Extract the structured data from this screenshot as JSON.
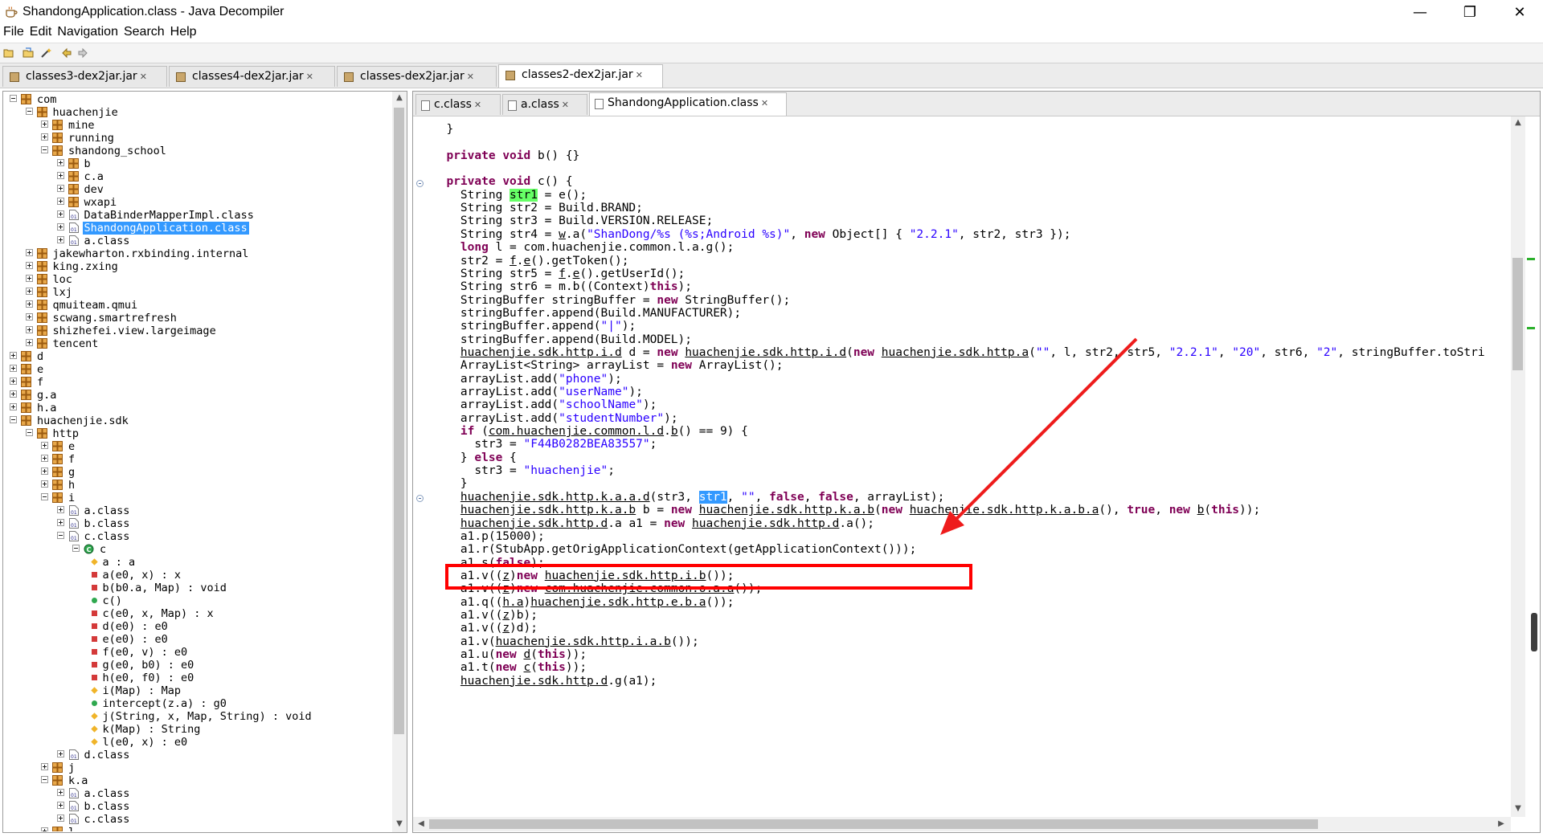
{
  "window": {
    "title": "ShandongApplication.class - Java Decompiler",
    "minimize_glyph": "—",
    "maximize_glyph": "❐",
    "close_glyph": "✕"
  },
  "menu": [
    "File",
    "Edit",
    "Navigation",
    "Search",
    "Help"
  ],
  "toolbar_icons": [
    "open-folder-icon",
    "open-file-icon",
    "wand-icon",
    "back-arrow-icon",
    "forward-arrow-icon"
  ],
  "jar_tabs": [
    {
      "label": "classes3-dex2jar.jar",
      "active": false
    },
    {
      "label": "classes4-dex2jar.jar",
      "active": false
    },
    {
      "label": "classes-dex2jar.jar",
      "active": false
    },
    {
      "label": "classes2-dex2jar.jar",
      "active": true
    }
  ],
  "file_tabs": [
    {
      "label": "c.class",
      "active": false
    },
    {
      "label": "a.class",
      "active": false
    },
    {
      "label": "ShandongApplication.class",
      "active": true
    }
  ],
  "tree": [
    {
      "label": "com",
      "depth": 0,
      "kind": "package",
      "exp": "minus"
    },
    {
      "label": "huachenjie",
      "depth": 1,
      "kind": "package",
      "exp": "minus"
    },
    {
      "label": "mine",
      "depth": 2,
      "kind": "package",
      "exp": "plus"
    },
    {
      "label": "running",
      "depth": 2,
      "kind": "package",
      "exp": "plus"
    },
    {
      "label": "shandong_school",
      "depth": 2,
      "kind": "package",
      "exp": "minus"
    },
    {
      "label": "b",
      "depth": 3,
      "kind": "package",
      "exp": "plus"
    },
    {
      "label": "c.a",
      "depth": 3,
      "kind": "package",
      "exp": "plus"
    },
    {
      "label": "dev",
      "depth": 3,
      "kind": "package",
      "exp": "plus"
    },
    {
      "label": "wxapi",
      "depth": 3,
      "kind": "package",
      "exp": "plus"
    },
    {
      "label": "DataBinderMapperImpl.class",
      "depth": 3,
      "kind": "class",
      "exp": "plus"
    },
    {
      "label": "ShandongApplication.class",
      "depth": 3,
      "kind": "class",
      "exp": "plus",
      "selected": true
    },
    {
      "label": "a.class",
      "depth": 3,
      "kind": "class",
      "exp": "plus"
    },
    {
      "label": "jakewharton.rxbinding.internal",
      "depth": 1,
      "kind": "package",
      "exp": "plus"
    },
    {
      "label": "king.zxing",
      "depth": 1,
      "kind": "package",
      "exp": "plus"
    },
    {
      "label": "loc",
      "depth": 1,
      "kind": "package",
      "exp": "plus"
    },
    {
      "label": "lxj",
      "depth": 1,
      "kind": "package",
      "exp": "plus"
    },
    {
      "label": "qmuiteam.qmui",
      "depth": 1,
      "kind": "package",
      "exp": "plus"
    },
    {
      "label": "scwang.smartrefresh",
      "depth": 1,
      "kind": "package",
      "exp": "plus"
    },
    {
      "label": "shizhefei.view.largeimage",
      "depth": 1,
      "kind": "package",
      "exp": "plus"
    },
    {
      "label": "tencent",
      "depth": 1,
      "kind": "package",
      "exp": "plus"
    },
    {
      "label": "d",
      "depth": 0,
      "kind": "package",
      "exp": "plus"
    },
    {
      "label": "e",
      "depth": 0,
      "kind": "package",
      "exp": "plus"
    },
    {
      "label": "f",
      "depth": 0,
      "kind": "package",
      "exp": "plus"
    },
    {
      "label": "g.a",
      "depth": 0,
      "kind": "package",
      "exp": "plus"
    },
    {
      "label": "h.a",
      "depth": 0,
      "kind": "package",
      "exp": "plus"
    },
    {
      "label": "huachenjie.sdk",
      "depth": 0,
      "kind": "package",
      "exp": "minus"
    },
    {
      "label": "http",
      "depth": 1,
      "kind": "package",
      "exp": "minus"
    },
    {
      "label": "e",
      "depth": 2,
      "kind": "package",
      "exp": "plus"
    },
    {
      "label": "f",
      "depth": 2,
      "kind": "package",
      "exp": "plus"
    },
    {
      "label": "g",
      "depth": 2,
      "kind": "package",
      "exp": "plus"
    },
    {
      "label": "h",
      "depth": 2,
      "kind": "package",
      "exp": "plus"
    },
    {
      "label": "i",
      "depth": 2,
      "kind": "package",
      "exp": "minus"
    },
    {
      "label": "a.class",
      "depth": 3,
      "kind": "class",
      "exp": "plus"
    },
    {
      "label": "b.class",
      "depth": 3,
      "kind": "class",
      "exp": "plus"
    },
    {
      "label": "c.class",
      "depth": 3,
      "kind": "class",
      "exp": "minus"
    },
    {
      "label": "c",
      "depth": 4,
      "kind": "type",
      "exp": "minus"
    },
    {
      "label": "a : a",
      "depth": 5,
      "kind": "field-default"
    },
    {
      "label": "a(e0, x) : x",
      "depth": 5,
      "kind": "method-private"
    },
    {
      "label": "b(b0.a, Map) : void",
      "depth": 5,
      "kind": "method-private"
    },
    {
      "label": "c()",
      "depth": 5,
      "kind": "method-public"
    },
    {
      "label": "c(e0, x, Map) : x",
      "depth": 5,
      "kind": "method-private"
    },
    {
      "label": "d(e0) : e0",
      "depth": 5,
      "kind": "method-private"
    },
    {
      "label": "e(e0) : e0",
      "depth": 5,
      "kind": "method-private"
    },
    {
      "label": "f(e0, v) : e0",
      "depth": 5,
      "kind": "method-private"
    },
    {
      "label": "g(e0, b0) : e0",
      "depth": 5,
      "kind": "method-private"
    },
    {
      "label": "h(e0, f0) : e0",
      "depth": 5,
      "kind": "method-private"
    },
    {
      "label": "i(Map) : Map",
      "depth": 5,
      "kind": "method-default-static"
    },
    {
      "label": "intercept(z.a) : g0",
      "depth": 5,
      "kind": "method-public"
    },
    {
      "label": "j(String, x, Map, String) : void",
      "depth": 5,
      "kind": "method-default"
    },
    {
      "label": "k(Map) : String",
      "depth": 5,
      "kind": "method-default"
    },
    {
      "label": "l(e0, x) : e0",
      "depth": 5,
      "kind": "method-default"
    },
    {
      "label": "d.class",
      "depth": 3,
      "kind": "class",
      "exp": "plus"
    },
    {
      "label": "j",
      "depth": 2,
      "kind": "package",
      "exp": "plus"
    },
    {
      "label": "k.a",
      "depth": 2,
      "kind": "package",
      "exp": "minus"
    },
    {
      "label": "a.class",
      "depth": 3,
      "kind": "class",
      "exp": "plus"
    },
    {
      "label": "b.class",
      "depth": 3,
      "kind": "class",
      "exp": "plus"
    },
    {
      "label": "c.class",
      "depth": 3,
      "kind": "class",
      "exp": "plus"
    },
    {
      "label": "l",
      "depth": 2,
      "kind": "package",
      "exp": "plus"
    }
  ],
  "code_lines": [
    [
      [
        "p",
        "  }"
      ]
    ],
    [
      [
        "p",
        ""
      ]
    ],
    [
      [
        "p",
        "  "
      ],
      [
        "k",
        "private"
      ],
      [
        "p",
        " "
      ],
      [
        "k",
        "void"
      ],
      [
        "p",
        " b() {}"
      ]
    ],
    [
      [
        "p",
        ""
      ]
    ],
    [
      [
        "p",
        "  "
      ],
      [
        "k",
        "private"
      ],
      [
        "p",
        " "
      ],
      [
        "k",
        "void"
      ],
      [
        "p",
        " c() {"
      ]
    ],
    [
      [
        "p",
        "    String "
      ],
      [
        "g",
        "str1"
      ],
      [
        "p",
        " = e();"
      ]
    ],
    [
      [
        "p",
        "    String str2 = Build.BRAND;"
      ]
    ],
    [
      [
        "p",
        "    String str3 = Build.VERSION.RELEASE;"
      ]
    ],
    [
      [
        "p",
        "    String str4 = "
      ],
      [
        "u",
        "w"
      ],
      [
        "p",
        ".a("
      ],
      [
        "s",
        "\"ShanDong/%s (%s;Android %s)\""
      ],
      [
        "p",
        ", "
      ],
      [
        "k",
        "new"
      ],
      [
        "p",
        " Object[] { "
      ],
      [
        "s",
        "\"2.2.1\""
      ],
      [
        "p",
        ", str2, str3 });"
      ]
    ],
    [
      [
        "p",
        "    "
      ],
      [
        "k",
        "long"
      ],
      [
        "p",
        " l = com.huachenjie.common.l.a.g();"
      ]
    ],
    [
      [
        "p",
        "    str2 = "
      ],
      [
        "u",
        "f"
      ],
      [
        "p",
        "."
      ],
      [
        "u",
        "e"
      ],
      [
        "p",
        "().getToken();"
      ]
    ],
    [
      [
        "p",
        "    String str5 = "
      ],
      [
        "u",
        "f"
      ],
      [
        "p",
        "."
      ],
      [
        "u",
        "e"
      ],
      [
        "p",
        "().getUserId();"
      ]
    ],
    [
      [
        "p",
        "    String str6 = m.b((Context)"
      ],
      [
        "k",
        "this"
      ],
      [
        "p",
        ");"
      ]
    ],
    [
      [
        "p",
        "    StringBuffer stringBuffer = "
      ],
      [
        "k",
        "new"
      ],
      [
        "p",
        " StringBuffer();"
      ]
    ],
    [
      [
        "p",
        "    stringBuffer.append(Build.MANUFACTURER);"
      ]
    ],
    [
      [
        "p",
        "    stringBuffer.append("
      ],
      [
        "s",
        "\"|\""
      ],
      [
        "p",
        ");"
      ]
    ],
    [
      [
        "p",
        "    stringBuffer.append(Build.MODEL);"
      ]
    ],
    [
      [
        "p",
        "    "
      ],
      [
        "u",
        "huachenjie.sdk.http.i.d"
      ],
      [
        "p",
        " d = "
      ],
      [
        "k",
        "new"
      ],
      [
        "p",
        " "
      ],
      [
        "u",
        "huachenjie.sdk.http.i.d"
      ],
      [
        "p",
        "("
      ],
      [
        "k",
        "new"
      ],
      [
        "p",
        " "
      ],
      [
        "u",
        "huachenjie.sdk.http.a"
      ],
      [
        "p",
        "("
      ],
      [
        "s",
        "\"\""
      ],
      [
        "p",
        ", l, str2, str5, "
      ],
      [
        "s",
        "\"2.2.1\""
      ],
      [
        "p",
        ", "
      ],
      [
        "s",
        "\"20\""
      ],
      [
        "p",
        ", str6, "
      ],
      [
        "s",
        "\"2\""
      ],
      [
        "p",
        ", stringBuffer.toStri"
      ]
    ],
    [
      [
        "p",
        "    ArrayList<String> arrayList = "
      ],
      [
        "k",
        "new"
      ],
      [
        "p",
        " ArrayList();"
      ]
    ],
    [
      [
        "p",
        "    arrayList.add("
      ],
      [
        "s",
        "\"phone\""
      ],
      [
        "p",
        ");"
      ]
    ],
    [
      [
        "p",
        "    arrayList.add("
      ],
      [
        "s",
        "\"userName\""
      ],
      [
        "p",
        ");"
      ]
    ],
    [
      [
        "p",
        "    arrayList.add("
      ],
      [
        "s",
        "\"schoolName\""
      ],
      [
        "p",
        ");"
      ]
    ],
    [
      [
        "p",
        "    arrayList.add("
      ],
      [
        "s",
        "\"studentNumber\""
      ],
      [
        "p",
        ");"
      ]
    ],
    [
      [
        "p",
        "    "
      ],
      [
        "k",
        "if"
      ],
      [
        "p",
        " ("
      ],
      [
        "u",
        "com.huachenjie.common.l.d"
      ],
      [
        "p",
        "."
      ],
      [
        "u",
        "b"
      ],
      [
        "p",
        "() == 9) {"
      ]
    ],
    [
      [
        "p",
        "      str3 = "
      ],
      [
        "s",
        "\"F44B0282BEA83557\""
      ],
      [
        "p",
        ";"
      ]
    ],
    [
      [
        "p",
        "    } "
      ],
      [
        "k",
        "else"
      ],
      [
        "p",
        " {"
      ]
    ],
    [
      [
        "p",
        "      str3 = "
      ],
      [
        "s",
        "\"huachenjie\""
      ],
      [
        "p",
        ";"
      ]
    ],
    [
      [
        "p",
        "    }"
      ]
    ],
    [
      [
        "p",
        "    "
      ],
      [
        "u",
        "huachenjie.sdk.http.k.a.a.d"
      ],
      [
        "p",
        "(str3, "
      ],
      [
        "b",
        "str1"
      ],
      [
        "p",
        ", "
      ],
      [
        "s",
        "\"\""
      ],
      [
        "p",
        ", "
      ],
      [
        "k",
        "false"
      ],
      [
        "p",
        ", "
      ],
      [
        "k",
        "false"
      ],
      [
        "p",
        ", arrayList);"
      ]
    ],
    [
      [
        "p",
        "    "
      ],
      [
        "u",
        "huachenjie.sdk.http.k.a.b"
      ],
      [
        "p",
        " b = "
      ],
      [
        "k",
        "new"
      ],
      [
        "p",
        " "
      ],
      [
        "u",
        "huachenjie.sdk.http.k.a.b"
      ],
      [
        "p",
        "("
      ],
      [
        "k",
        "new"
      ],
      [
        "p",
        " "
      ],
      [
        "u",
        "huachenjie.sdk.http.k.a.b.a"
      ],
      [
        "p",
        "(), "
      ],
      [
        "k",
        "true"
      ],
      [
        "p",
        ", "
      ],
      [
        "k",
        "new"
      ],
      [
        "p",
        " "
      ],
      [
        "u",
        "b"
      ],
      [
        "p",
        "("
      ],
      [
        "k",
        "this"
      ],
      [
        "p",
        "));"
      ]
    ],
    [
      [
        "p",
        "    "
      ],
      [
        "u",
        "huachenjie.sdk.http.d"
      ],
      [
        "p",
        ".a a1 = "
      ],
      [
        "k",
        "new"
      ],
      [
        "p",
        " "
      ],
      [
        "u",
        "huachenjie.sdk.http.d"
      ],
      [
        "p",
        ".a();"
      ]
    ],
    [
      [
        "p",
        "    a1.p(15000);"
      ]
    ],
    [
      [
        "p",
        "    a1.r(StubApp.getOrigApplicationContext(getApplicationContext()));"
      ]
    ],
    [
      [
        "p",
        "    a1.s("
      ],
      [
        "k",
        "false"
      ],
      [
        "p",
        ");"
      ]
    ],
    [
      [
        "p",
        "    a1.v(("
      ],
      [
        "u",
        "z"
      ],
      [
        "p",
        ")"
      ],
      [
        "k",
        "new"
      ],
      [
        "p",
        " "
      ],
      [
        "u",
        "huachenjie.sdk.http.i.b"
      ],
      [
        "p",
        "());"
      ]
    ],
    [
      [
        "p",
        "    a1.v(("
      ],
      [
        "u",
        "z"
      ],
      [
        "p",
        ")"
      ],
      [
        "k",
        "new"
      ],
      [
        "p",
        " "
      ],
      [
        "u",
        "com.huachenjie.common.o.a.a"
      ],
      [
        "p",
        "());"
      ]
    ],
    [
      [
        "p",
        "    a1.q(("
      ],
      [
        "u",
        "h.a"
      ],
      [
        "p",
        ")"
      ],
      [
        "u",
        "huachenjie.sdk.http.e.b.a"
      ],
      [
        "p",
        "());"
      ]
    ],
    [
      [
        "p",
        "    a1.v(("
      ],
      [
        "u",
        "z"
      ],
      [
        "p",
        ")b);"
      ]
    ],
    [
      [
        "p",
        "    a1.v(("
      ],
      [
        "u",
        "z"
      ],
      [
        "p",
        ")d);"
      ]
    ],
    [
      [
        "p",
        "    a1.v("
      ],
      [
        "u",
        "huachenjie.sdk.http.i.a.b"
      ],
      [
        "p",
        "());"
      ]
    ],
    [
      [
        "p",
        "    a1.u("
      ],
      [
        "k",
        "new"
      ],
      [
        "p",
        " "
      ],
      [
        "u",
        "d"
      ],
      [
        "p",
        "("
      ],
      [
        "k",
        "this"
      ],
      [
        "p",
        "));"
      ]
    ],
    [
      [
        "p",
        "    a1.t("
      ],
      [
        "k",
        "new"
      ],
      [
        "p",
        " "
      ],
      [
        "u",
        "c"
      ],
      [
        "p",
        "("
      ],
      [
        "k",
        "this"
      ],
      [
        "p",
        "));"
      ]
    ],
    [
      [
        "p",
        "    "
      ],
      [
        "u",
        "huachenjie.sdk.http.d"
      ],
      [
        "p",
        ".g(a1);"
      ]
    ]
  ],
  "colors": {
    "keyword": "#7f0055",
    "string": "#2a00ff",
    "highlight_green": "#66ff66",
    "selection_blue": "#3399ff",
    "annotation_red": "#ff0000",
    "package_icon": "#c9882a"
  }
}
